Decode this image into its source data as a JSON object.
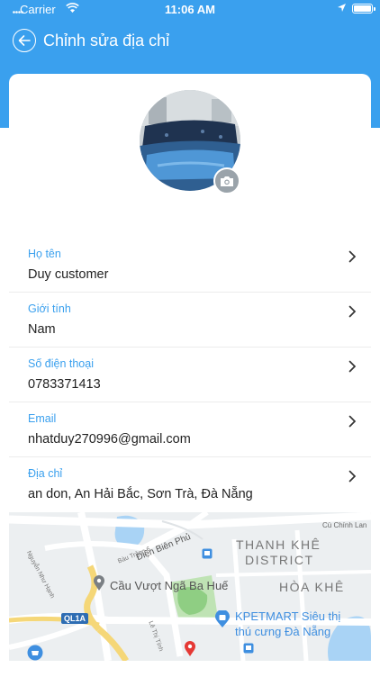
{
  "status": {
    "carrier": "Carrier",
    "time": "11:06 AM"
  },
  "header": {
    "title": "Chỉnh sửa địa chỉ"
  },
  "profile": {
    "avatar_alt": "Avatar"
  },
  "fields": [
    {
      "label": "Họ tên",
      "value": "Duy customer"
    },
    {
      "label": "Giới tính",
      "value": "Nam"
    },
    {
      "label": "Số điện thoại",
      "value": "0783371413"
    },
    {
      "label": "Email",
      "value": "nhatduy270996@gmail.com"
    },
    {
      "label": "Địa chỉ",
      "value": "an don, An Hải Bắc, Sơn Trà, Đà Nẵng"
    }
  ],
  "map": {
    "street1": "Cù Chính Lan",
    "street2": "Điện Biên Phủ",
    "street3": "Bàu Trảng 6",
    "street4": "Nguyễn Như Hạnh",
    "street5": "Lê Thị Tính",
    "district1": "THANH KHÊ",
    "district2": "DISTRICT",
    "ward": "HÒA KHÊ",
    "poi1": "Cầu Vượt Ngã Ba Huế",
    "poi2a": "KPETMART Siêu thị",
    "poi2b": "thú cưng Đà Nẵng",
    "road_badge": "QL1A"
  },
  "colors": {
    "accent": "#3aa0ee",
    "text": "#222222"
  }
}
